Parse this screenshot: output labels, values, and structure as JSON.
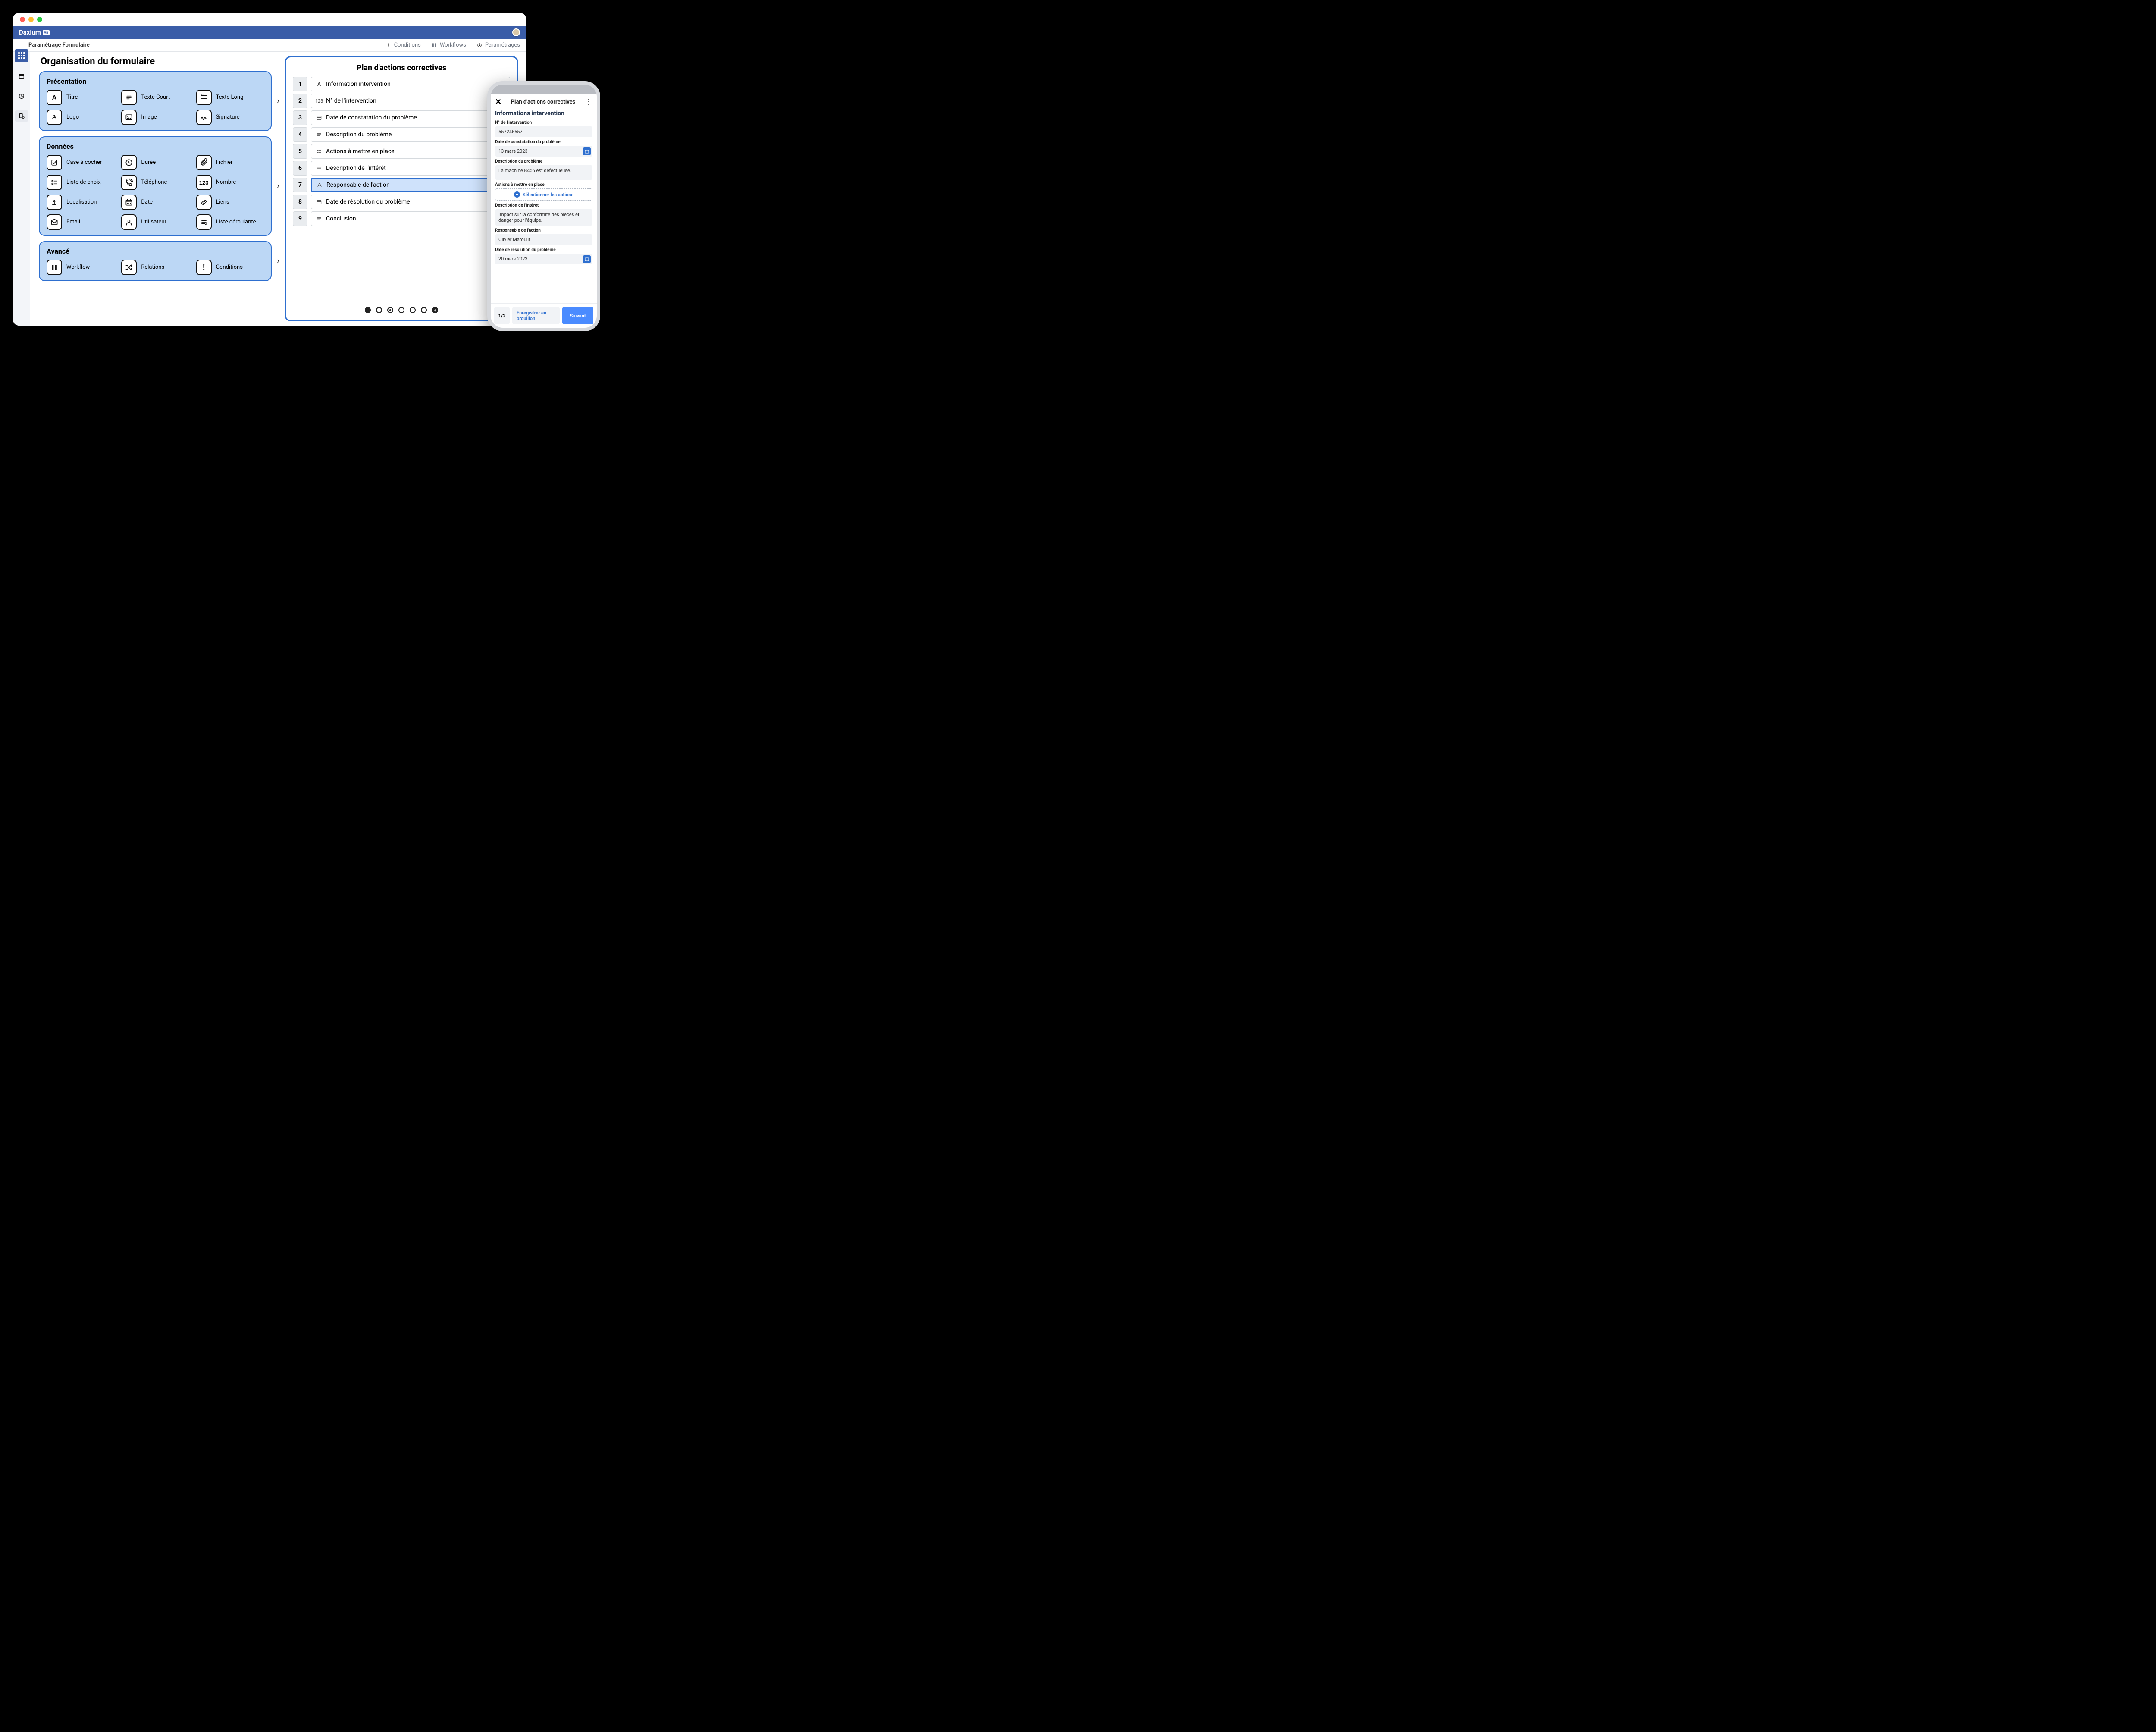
{
  "brand": {
    "name": "Daxium",
    "badge": "Air"
  },
  "toolbar": {
    "left": "Paramétrage Formulaire",
    "conditions": "Conditions",
    "workflows": "Workflows",
    "parametrages": "Paramétrages"
  },
  "page_title": "Organisation du formulaire",
  "panels": {
    "presentation": {
      "title": "Présentation",
      "items": [
        {
          "label": "Titre",
          "icon": "A"
        },
        {
          "label": "Texte Court",
          "icon": "text-short"
        },
        {
          "label": "Texte Long",
          "icon": "text-long"
        },
        {
          "label": "Logo",
          "icon": "logo"
        },
        {
          "label": "Image",
          "icon": "image"
        },
        {
          "label": "Signature",
          "icon": "signature"
        }
      ]
    },
    "donnees": {
      "title": "Données",
      "items": [
        {
          "label": "Case à cocher",
          "icon": "checkbox"
        },
        {
          "label": "Durée",
          "icon": "duration"
        },
        {
          "label": "Fichier",
          "icon": "paperclip"
        },
        {
          "label": "Liste de choix",
          "icon": "choicelist"
        },
        {
          "label": "Téléphone",
          "icon": "phone"
        },
        {
          "label": "Nombre",
          "icon": "123"
        },
        {
          "label": "Localisation",
          "icon": "pin"
        },
        {
          "label": "Date",
          "icon": "calendar"
        },
        {
          "label": "Liens",
          "icon": "link"
        },
        {
          "label": "Email",
          "icon": "mail"
        },
        {
          "label": "Utilisateur",
          "icon": "user"
        },
        {
          "label": "Liste déroulante",
          "icon": "dropdown"
        }
      ]
    },
    "avance": {
      "title": "Avancé",
      "items": [
        {
          "label": "Workflow",
          "icon": "workflow"
        },
        {
          "label": "Relations",
          "icon": "shuffle"
        },
        {
          "label": "Conditions",
          "icon": "!"
        }
      ]
    }
  },
  "form": {
    "title": "Plan d'actions correctives",
    "selected_index": 6,
    "rows": [
      {
        "n": "1",
        "icon": "A",
        "label": "Information intervention"
      },
      {
        "n": "2",
        "icon": "123",
        "label": "N° de l'intervention"
      },
      {
        "n": "3",
        "icon": "calendar",
        "label": "Date de constatation du problème"
      },
      {
        "n": "4",
        "icon": "text",
        "label": "Description du problème"
      },
      {
        "n": "5",
        "icon": "list",
        "label": "Actions à mettre en place"
      },
      {
        "n": "6",
        "icon": "text",
        "label": "Description de l'intérêt"
      },
      {
        "n": "7",
        "icon": "user",
        "label": "Responsable de l'action"
      },
      {
        "n": "8",
        "icon": "calendar",
        "label": "Date de résolution du problème"
      },
      {
        "n": "9",
        "icon": "text",
        "label": "Conclusion"
      }
    ]
  },
  "phone": {
    "title": "Plan d'actions correctives",
    "section_title": "Informations intervention",
    "fields": {
      "num_label": "N° de l'intervention",
      "num_value": "557245557",
      "date_const_label": "Date de constatation du problème",
      "date_const_value": "13 mars 2023",
      "desc_prob_label": "Description du problème",
      "desc_prob_value": "La machine B456 est défectueuse.",
      "actions_label": "Actions à mettre en place",
      "actions_select": "Sélectionner les actions",
      "desc_int_label": "Description de l'intérêt",
      "desc_int_value": "Impact sur la conformité des pièces et danger pour l'équipe.",
      "resp_label": "Responsable de l'action",
      "resp_value": "Olivier Maroulit",
      "date_res_label": "Date de résolution du problème",
      "date_res_value": "20 mars 2023"
    },
    "footer": {
      "counter": "1/2",
      "draft": "Enregistrer en brouillon",
      "next": "Suivant"
    }
  }
}
